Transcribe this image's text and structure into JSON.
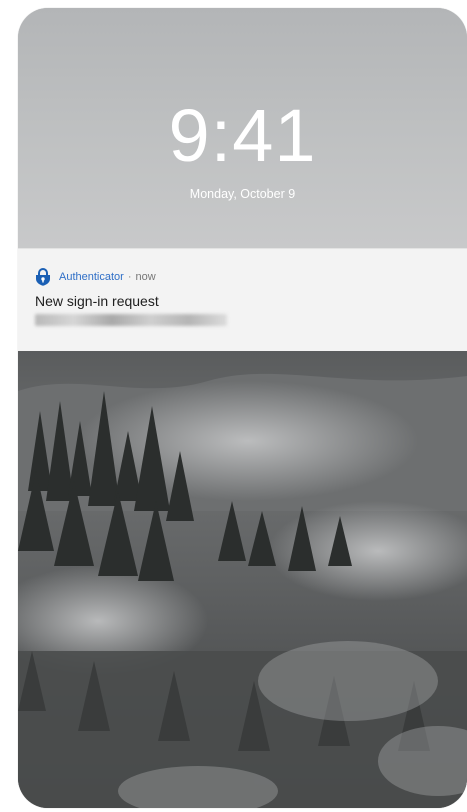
{
  "lockscreen": {
    "time": "9:41",
    "date": "Monday, October 9"
  },
  "notification": {
    "app_icon": "lock-shield-icon",
    "app_name": "Authenticator",
    "separator": "·",
    "timestamp": "now",
    "title": "New sign-in request",
    "subtitle": "",
    "colors": {
      "app_name": "#2f6fc7",
      "icon": "#1a5fb4"
    }
  }
}
